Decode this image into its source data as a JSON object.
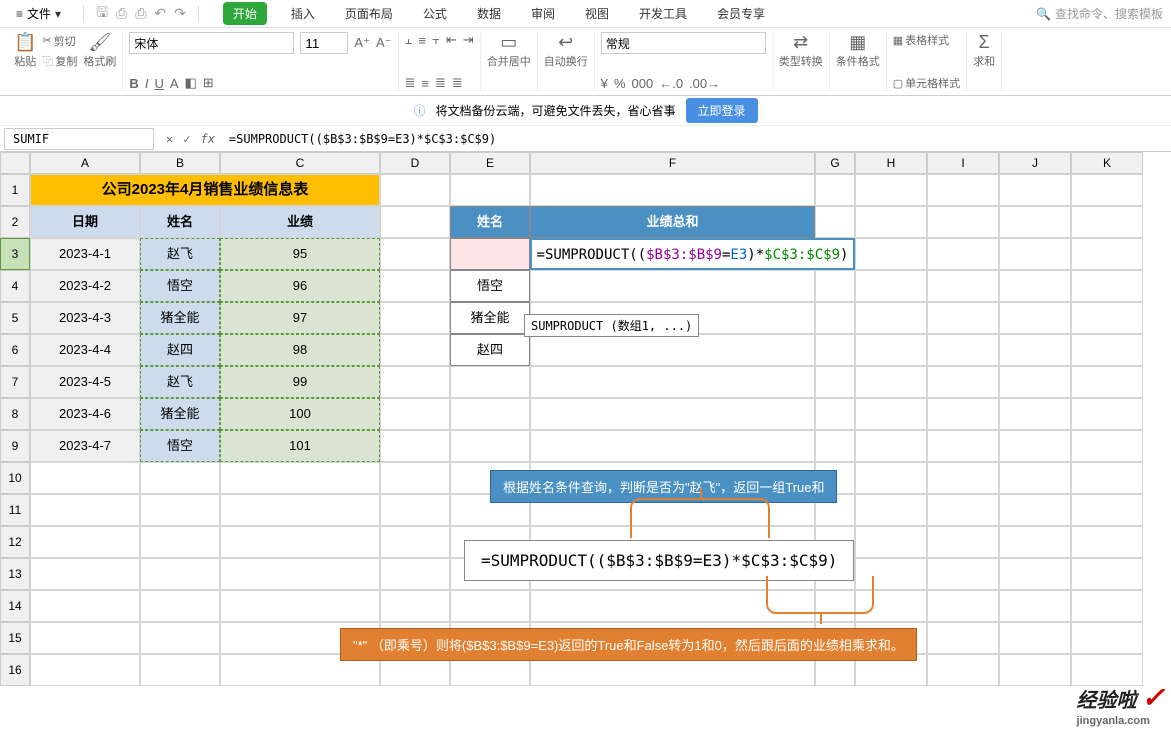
{
  "menubar": {
    "file_label": "文件",
    "tabs": [
      "开始",
      "插入",
      "页面布局",
      "公式",
      "数据",
      "审阅",
      "视图",
      "开发工具",
      "会员专享"
    ],
    "search_placeholder": "查找命令、搜索模板"
  },
  "ribbon": {
    "paste": "粘贴",
    "cut": "剪切",
    "copy": "复制",
    "format_painter": "格式刷",
    "font_name": "宋体",
    "font_size": "11",
    "merge_center": "合并居中",
    "wrap_text": "自动换行",
    "number_format": "常规",
    "type_convert": "类型转换",
    "cond_format": "条件格式",
    "table_style": "表格样式",
    "cell_style": "单元格样式",
    "sum": "求和"
  },
  "notice": {
    "text": "将文档备份云端，可避免文件丢失，省心省事",
    "login": "立即登录"
  },
  "formula_bar": {
    "name_box": "SUMIF",
    "formula": "=SUMPRODUCT(($B$3:$B$9=E3)*$C$3:$C$9)"
  },
  "columns": [
    "A",
    "B",
    "C",
    "D",
    "E",
    "F",
    "G",
    "H",
    "I",
    "J",
    "K"
  ],
  "row_nums": [
    "1",
    "2",
    "3",
    "4",
    "5",
    "6",
    "7",
    "8",
    "9",
    "10",
    "11",
    "12",
    "13",
    "14",
    "15",
    "16"
  ],
  "table": {
    "title": "公司2023年4月销售业绩信息表",
    "headers": [
      "日期",
      "姓名",
      "业绩"
    ],
    "rows": [
      [
        "2023-4-1",
        "赵飞",
        "95"
      ],
      [
        "2023-4-2",
        "悟空",
        "96"
      ],
      [
        "2023-4-3",
        "猪全能",
        "97"
      ],
      [
        "2023-4-4",
        "赵四",
        "98"
      ],
      [
        "2023-4-5",
        "赵飞",
        "99"
      ],
      [
        "2023-4-6",
        "猪全能",
        "100"
      ],
      [
        "2023-4-7",
        "悟空",
        "101"
      ]
    ]
  },
  "lookup": {
    "headers": [
      "姓名",
      "业绩总和"
    ],
    "edit_formula_parts": {
      "pre": "=SUMPRODUCT((",
      "p1": "$B$3:$B$9",
      "eq": "=",
      "p2": "E3",
      "mid": ")*",
      "p3": "$C$3:$C$9",
      "end": ")"
    },
    "tooltip": "SUMPRODUCT (数组1, ...)",
    "names": [
      "悟空",
      "猪全能",
      "赵四"
    ]
  },
  "callouts": {
    "c1": "根据姓名条件查询，判断是否为\"赵飞\"，返回一组True和",
    "big": "=SUMPRODUCT(($B$3:$B$9=E3)*$C$3:$C$9)",
    "c2": "\"*\" （即乘号）则将($B$3:$B$9=E3)返回的True和False转为1和0，然后跟后面的业绩相乘求和。"
  },
  "watermark": {
    "main": "经验啦",
    "sub": "jingyanla.com"
  },
  "icons": {
    "menu": "≡",
    "dropdown": "▾",
    "save": "🖫",
    "print": "⎙",
    "undo": "↶",
    "redo": "↷",
    "search": "🔍",
    "info": "ⓘ",
    "fx": "fx",
    "cancel": "✕",
    "ok": "✓",
    "paste": "📋",
    "scissors": "✂",
    "copy": "⿻",
    "brush": "🖌",
    "bold": "B",
    "italic": "I",
    "underline": "U",
    "fill": "A",
    "border": "⊞",
    "left": "≡",
    "center": "≡",
    "right": "≡",
    "grid": "⊞",
    "wrap": "↩",
    "yen": "¥",
    "percent": "%",
    "comma": "000",
    "dec_inc": "←.0",
    "dec_dec": ".00→",
    "sigma": "Σ"
  }
}
